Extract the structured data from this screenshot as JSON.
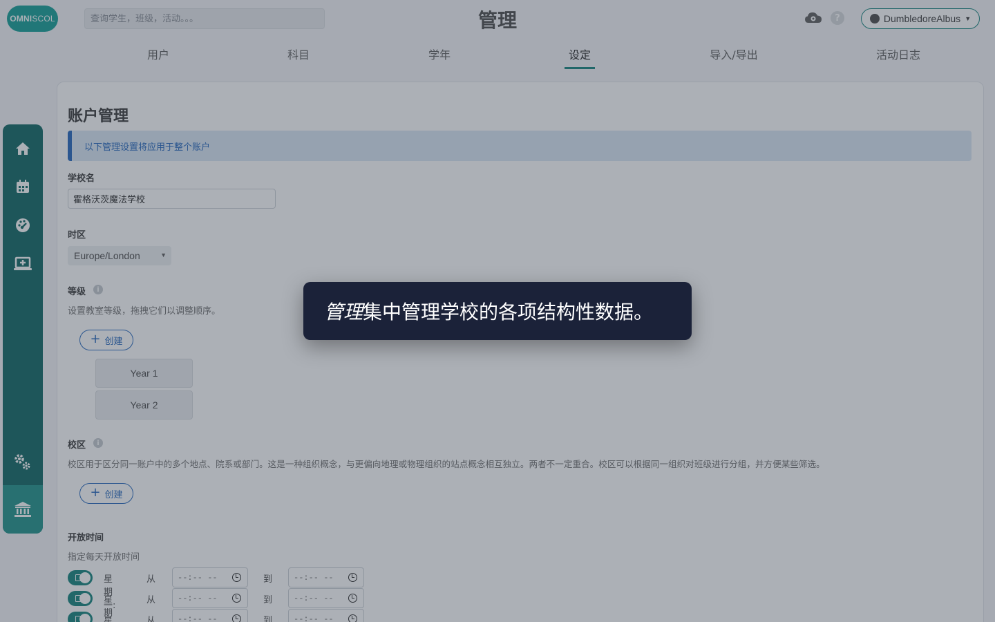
{
  "header": {
    "logo_bold": "OMNI",
    "logo_thin": "SCOL",
    "search_placeholder": "查询学生，班级，活动。。。",
    "title": "管理",
    "help_label": "?",
    "user_name": "DumbledoreAlbus"
  },
  "tabs": [
    {
      "label": "用户",
      "active": false
    },
    {
      "label": "科目",
      "active": false
    },
    {
      "label": "学年",
      "active": false
    },
    {
      "label": "设定",
      "active": true
    },
    {
      "label": "导入/导出",
      "active": false
    },
    {
      "label": "活动日志",
      "active": false
    }
  ],
  "sidebar": {
    "items": [
      "home-icon",
      "calendar-icon",
      "dashboard-icon",
      "screen-icon",
      "settings-icon",
      "institution-icon"
    ],
    "active": "institution-icon"
  },
  "content": {
    "section_title": "账户管理",
    "info_text": "以下管理设置将应用于整个账户",
    "school_label": "学校名",
    "school_value": "霍格沃茨魔法学校",
    "timezone_label": "时区",
    "timezone_value": "Europe/London",
    "grades_label": "等级",
    "grades_desc": "设置教室等级，拖拽它们以调整顺序。",
    "create_label": "创建",
    "grades": [
      "Year 1",
      "Year 2"
    ],
    "campus_label": "校区",
    "campus_desc": "校区用于区分同一账户中的多个地点、院系或部门。这是一种组织概念，与更偏向地理或物理组织的站点概念相互独立。两者不一定重合。校区可以根据同一组织对班级进行分组，并方便某些筛选。",
    "hours_label": "开放时间",
    "hours_desc": "指定每天开放时间",
    "from_label": "从",
    "to_label": "到",
    "time_placeholder": "--:-- --",
    "days": [
      "星期一:",
      "星期二:",
      "星期三:"
    ]
  },
  "tooltip": {
    "emphasis": "管理",
    "text": "集中管理学校的各项结构性数据。"
  },
  "colors": {
    "brand": "#1f8a84",
    "sidebar": "#1b6f6b",
    "accent_blue": "#2f6fc0",
    "tooltip_bg": "#1b2239"
  }
}
